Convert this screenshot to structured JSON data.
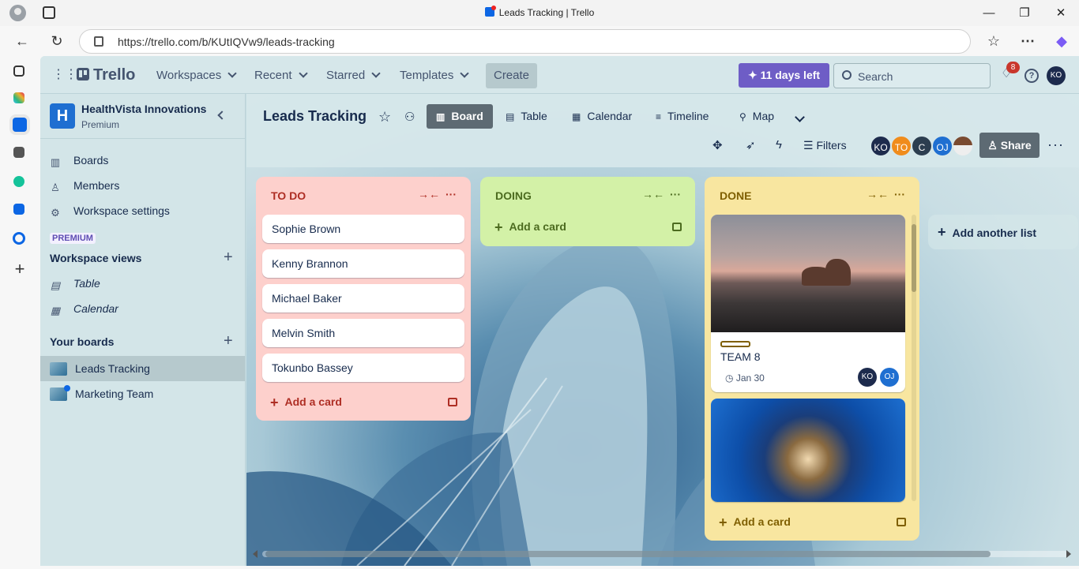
{
  "browser": {
    "window_title": "Leads Tracking | Trello",
    "url": "https://trello.com/b/KUtIQVw9/leads-tracking"
  },
  "topbar": {
    "logo": "Trello",
    "menus": [
      "Workspaces",
      "Recent",
      "Starred",
      "Templates"
    ],
    "create_label": "Create",
    "trial_label": "11 days left",
    "search_placeholder": "Search",
    "notification_count": "8",
    "help_label": "?",
    "user_initials": "KO"
  },
  "workspace": {
    "initial": "H",
    "name": "HealthVista Innovations",
    "plan": "Premium",
    "nav": [
      {
        "label": "Boards",
        "icon": "board-icon"
      },
      {
        "label": "Members",
        "icon": "person-icon"
      },
      {
        "label": "Workspace settings",
        "icon": "gear-icon"
      }
    ],
    "premium_tag": "PREMIUM",
    "views_title": "Workspace views",
    "views": [
      {
        "label": "Table",
        "icon": "table-icon"
      },
      {
        "label": "Calendar",
        "icon": "calendar-icon"
      }
    ],
    "boards_title": "Your boards",
    "boards": [
      {
        "label": "Leads Tracking",
        "active": true
      },
      {
        "label": "Marketing Team",
        "active": false
      }
    ]
  },
  "board": {
    "title": "Leads Tracking",
    "views": [
      "Board",
      "Table",
      "Calendar",
      "Timeline",
      "Map"
    ],
    "active_view": "Board",
    "filters_label": "Filters",
    "members": [
      {
        "initials": "KO",
        "color": "#1d2b4d"
      },
      {
        "initials": "TO",
        "color": "#f08c1c"
      },
      {
        "initials": "C",
        "color": "#2c3e50"
      },
      {
        "initials": "OJ",
        "color": "#1f6fd1"
      },
      {
        "initials": "",
        "color": "#c9ccd1"
      }
    ],
    "share_label": "Share",
    "add_list_label": "Add another list"
  },
  "lists": [
    {
      "title": "TO DO",
      "bg": "#fdd0cc",
      "fg": "#ae2e24",
      "cards": [
        "Sophie Brown",
        "Kenny Brannon",
        "Michael Baker",
        "Melvin Smith",
        "Tokunbo Bassey"
      ],
      "add_label": "Add a card"
    },
    {
      "title": "DOING",
      "bg": "#d3f1a7",
      "fg": "#4c6b1f",
      "cards": [],
      "add_label": "Add a card"
    },
    {
      "title": "DONE",
      "bg": "#f8e6a0",
      "fg": "#7f5f01",
      "cards": [
        {
          "name": "TEAM 8",
          "due": "Jan 30",
          "members": [
            "KO",
            "OJ"
          ]
        }
      ],
      "add_label": "Add a card"
    }
  ]
}
